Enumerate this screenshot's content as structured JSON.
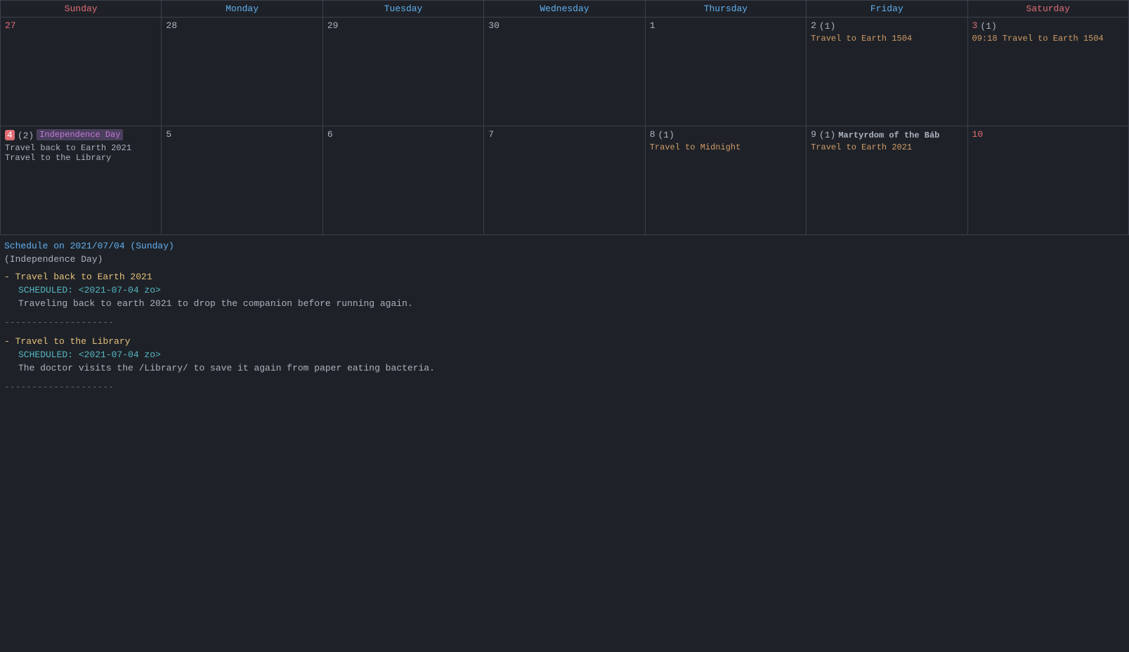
{
  "calendar": {
    "headers": [
      {
        "label": "Sunday",
        "class": "sunday"
      },
      {
        "label": "Monday",
        "class": "monday"
      },
      {
        "label": "Tuesday",
        "class": "tuesday"
      },
      {
        "label": "Wednesday",
        "class": "wednesday"
      },
      {
        "label": "Thursday",
        "class": "thursday"
      },
      {
        "label": "Friday",
        "class": "friday"
      },
      {
        "label": "Saturday",
        "class": "saturday"
      }
    ],
    "weeks": [
      {
        "days": [
          {
            "num": "27",
            "numClass": "sunday-num",
            "events": []
          },
          {
            "num": "28",
            "numClass": "",
            "events": []
          },
          {
            "num": "29",
            "numClass": "",
            "events": []
          },
          {
            "num": "30",
            "numClass": "",
            "events": []
          },
          {
            "num": "1",
            "numClass": "",
            "events": []
          },
          {
            "num": "2",
            "numClass": "",
            "count": "(1)",
            "events": [
              {
                "text": "Travel to Earth 1504",
                "color": "orange"
              }
            ]
          },
          {
            "num": "3",
            "numClass": "saturday-num",
            "count": "(1)",
            "events": [
              {
                "text": "09:18 Travel to Earth 1504",
                "color": "orange"
              }
            ]
          }
        ]
      },
      {
        "days": [
          {
            "num": "4",
            "numClass": "sunday-num today",
            "badge": "Independence Day",
            "count": "(2)",
            "events": [
              {
                "text": "Travel back to Earth 2021",
                "color": "white"
              },
              {
                "text": "Travel to the Library",
                "color": "white"
              }
            ]
          },
          {
            "num": "5",
            "numClass": "",
            "events": []
          },
          {
            "num": "6",
            "numClass": "",
            "events": []
          },
          {
            "num": "7",
            "numClass": "",
            "events": []
          },
          {
            "num": "8",
            "numClass": "",
            "count": "(1)",
            "events": [
              {
                "text": "Travel to Midnight",
                "color": "orange"
              }
            ]
          },
          {
            "num": "9",
            "numClass": "",
            "count": "(1)",
            "badge2": "Martyrdom of the Báb",
            "events": [
              {
                "text": "Travel to Earth 2021",
                "color": "orange"
              }
            ]
          },
          {
            "num": "10",
            "numClass": "saturday-num",
            "events": []
          }
        ]
      }
    ]
  },
  "schedule": {
    "header": "Schedule on 2021/07/04 (Sunday)",
    "holiday": "(Independence Day)",
    "items": [
      {
        "title": "- Travel back to Earth 2021",
        "scheduled": "SCHEDULED: <2021-07-04 zo>",
        "desc": "Traveling back to earth 2021 to drop the companion before running again."
      },
      {
        "title": "- Travel to the Library",
        "scheduled": "SCHEDULED: <2021-07-04 zo>",
        "desc": "The doctor visits the /Library/ to save it again from paper eating bacteria."
      }
    ],
    "divider": "--------------------"
  }
}
